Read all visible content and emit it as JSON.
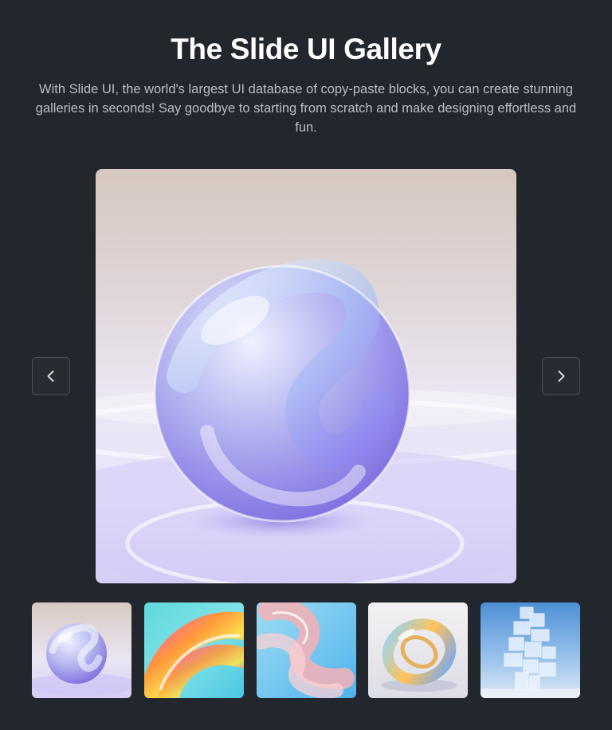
{
  "header": {
    "title": "The Slide UI Gallery",
    "subtitle": "With Slide UI, the world's largest UI database of copy-paste blocks, you can create stunning galleries in seconds! Say goodbye to starting from scratch and make designing effortless and fun."
  },
  "gallery": {
    "selected_index": 0,
    "prev_icon": "chevron-left-icon",
    "next_icon": "chevron-right-icon",
    "thumbnails": [
      {
        "subject": "glass-sphere-image"
      },
      {
        "subject": "rainbow-wave-image"
      },
      {
        "subject": "pink-glass-ribbon-image"
      },
      {
        "subject": "glass-ring-image"
      },
      {
        "subject": "glass-cubes-tower-image"
      }
    ]
  },
  "colors": {
    "background": "#22272e",
    "title": "#ffffff",
    "subtitle": "#b8bdc4",
    "button_border": "#4a5059"
  }
}
